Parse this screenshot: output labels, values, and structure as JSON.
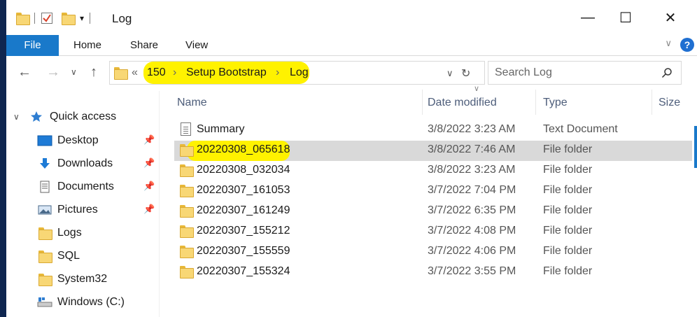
{
  "window": {
    "title": "Log",
    "minimize": "—",
    "maximize": "☐",
    "close": "✕"
  },
  "ribbon": {
    "tabs": [
      "File",
      "Home",
      "Share",
      "View"
    ],
    "help": "?",
    "expand_glyph": "∨"
  },
  "navigation": {
    "back": "←",
    "forward": "→",
    "recent": "∨",
    "up": "↑"
  },
  "address": {
    "overflow": "«",
    "crumbs": [
      "150",
      "Setup Bootstrap",
      "Log"
    ],
    "separator": "›",
    "dropdown": "∨",
    "refresh": "↻"
  },
  "search": {
    "placeholder": "Search Log",
    "icon": "⚲"
  },
  "sidebar": {
    "quick_access": "Quick access",
    "items": [
      {
        "label": "Desktop",
        "icon": "desktop-icon",
        "pinned": true
      },
      {
        "label": "Downloads",
        "icon": "downloads-icon",
        "pinned": true
      },
      {
        "label": "Documents",
        "icon": "documents-icon",
        "pinned": true
      },
      {
        "label": "Pictures",
        "icon": "pictures-icon",
        "pinned": true
      },
      {
        "label": "Logs",
        "icon": "folder-icon",
        "pinned": false
      },
      {
        "label": "SQL",
        "icon": "folder-icon",
        "pinned": false
      },
      {
        "label": "System32",
        "icon": "folder-icon",
        "pinned": false
      },
      {
        "label": "Windows (C:)",
        "icon": "drive-icon",
        "pinned": false
      }
    ]
  },
  "columns": {
    "name": "Name",
    "date": "Date modified",
    "type": "Type",
    "size": "Size"
  },
  "files": [
    {
      "name": "Summary",
      "date": "3/8/2022 3:23 AM",
      "type": "Text Document",
      "kind": "document"
    },
    {
      "name": "20220308_065618",
      "date": "3/8/2022 7:46 AM",
      "type": "File folder",
      "kind": "folder",
      "selected": true
    },
    {
      "name": "20220308_032034",
      "date": "3/8/2022 3:23 AM",
      "type": "File folder",
      "kind": "folder"
    },
    {
      "name": "20220307_161053",
      "date": "3/7/2022 7:04 PM",
      "type": "File folder",
      "kind": "folder"
    },
    {
      "name": "20220307_161249",
      "date": "3/7/2022 6:35 PM",
      "type": "File folder",
      "kind": "folder"
    },
    {
      "name": "20220307_155212",
      "date": "3/7/2022 4:08 PM",
      "type": "File folder",
      "kind": "folder"
    },
    {
      "name": "20220307_155559",
      "date": "3/7/2022 4:06 PM",
      "type": "File folder",
      "kind": "folder"
    },
    {
      "name": "20220307_155324",
      "date": "3/7/2022 3:55 PM",
      "type": "File folder",
      "kind": "folder"
    }
  ],
  "colors": {
    "accent": "#1979ca",
    "highlight": "#fff200",
    "selection": "#d9d9d9"
  }
}
